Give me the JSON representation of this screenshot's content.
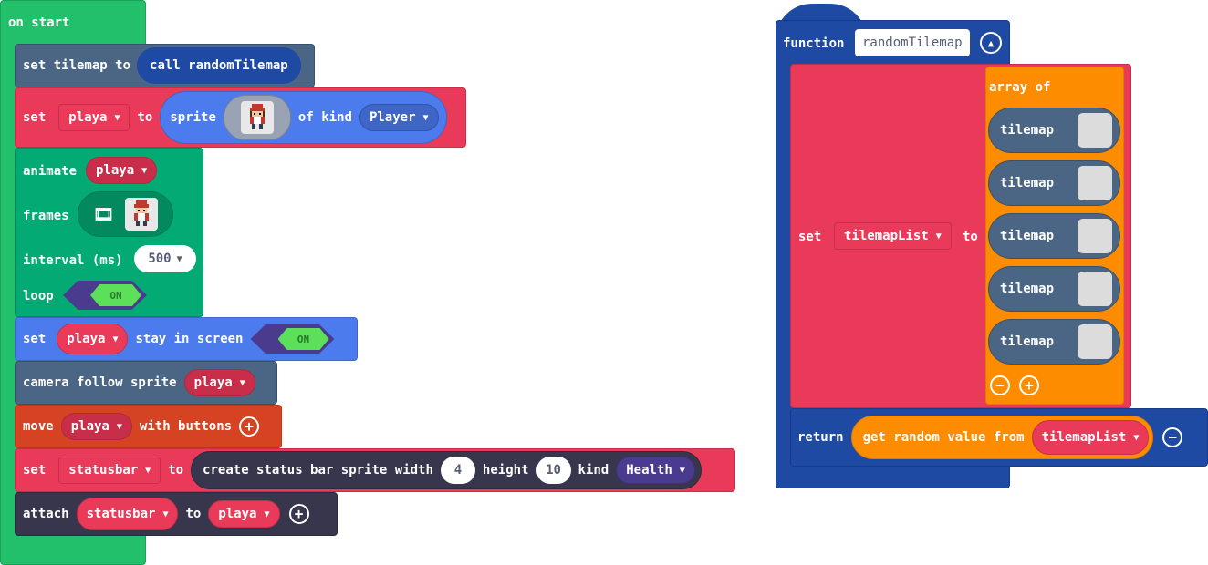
{
  "on_start": {
    "hat": "on start",
    "set_tilemap": {
      "set": "set tilemap to",
      "call": "call randomTilemap"
    },
    "set_playa": {
      "set": "set",
      "var": "playa",
      "to": "to",
      "sprite": "sprite",
      "of_kind": "of kind",
      "kind": "Player"
    },
    "animate": {
      "label": "animate",
      "var": "playa",
      "frames": "frames",
      "interval": "interval (ms)",
      "interval_value": "500",
      "loop": "loop",
      "loop_state": "ON"
    },
    "stay": {
      "set": "set",
      "var": "playa",
      "text": "stay in screen",
      "state": "ON"
    },
    "camera": {
      "text": "camera follow sprite",
      "var": "playa"
    },
    "move": {
      "move": "move",
      "var": "playa",
      "with": "with buttons"
    },
    "statusbar": {
      "set": "set",
      "var": "statusbar",
      "to": "to",
      "create": "create status bar sprite width",
      "width": "4",
      "height_lbl": "height",
      "height": "10",
      "kind_lbl": "kind",
      "kind": "Health"
    },
    "attach": {
      "attach": "attach",
      "var": "statusbar",
      "to": "to",
      "target": "playa"
    }
  },
  "function": {
    "keyword": "function",
    "name": "randomTilemap",
    "set": "set",
    "var": "tilemapList",
    "to": "to",
    "array_of": "array of",
    "items": [
      "tilemap",
      "tilemap",
      "tilemap",
      "tilemap",
      "tilemap"
    ],
    "return": "return",
    "get_random": "get random value from",
    "list": "tilemapList"
  },
  "colors": {
    "loops_green": "#23c06b",
    "scene_slate": "#4b6584",
    "variables_red": "#ea3a59",
    "sprites_blue": "#4b7bec",
    "animation_teal": "#03aa74",
    "controller_orange": "#d54322",
    "statusbar_dark": "#38364d",
    "functions_navy": "#1e4aa3",
    "arrays_orange": "#fe8c00",
    "health_purple": "#4b3b8f"
  }
}
